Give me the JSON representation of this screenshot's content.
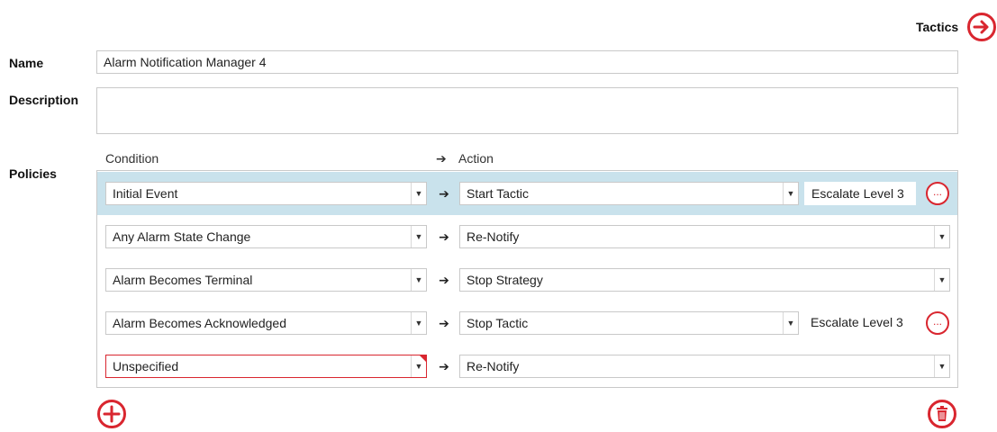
{
  "header": {
    "tactics_label": "Tactics"
  },
  "form": {
    "name_label": "Name",
    "name_value": "Alarm Notification Manager 4",
    "description_label": "Description",
    "description_value": "",
    "policies_label": "Policies"
  },
  "policies": {
    "condition_header": "Condition",
    "action_header_arrow": "➔",
    "action_header": "Action",
    "rows": [
      {
        "condition": "Initial Event",
        "action": "Start Tactic",
        "tactic": "Escalate Level 3",
        "selected": true
      },
      {
        "condition": "Any Alarm State Change",
        "action": "Re-Notify",
        "tactic": ""
      },
      {
        "condition": "Alarm Becomes Terminal",
        "action": "Stop Strategy",
        "tactic": ""
      },
      {
        "condition": "Alarm Becomes Acknowledged",
        "action": "Stop Tactic",
        "tactic": "Escalate Level 3"
      },
      {
        "condition": "Unspecified",
        "action": "Re-Notify",
        "tactic": "",
        "invalid": true
      }
    ],
    "row_arrow": "➔",
    "ellipsis": "..."
  },
  "colors": {
    "accent": "#d9262f",
    "selected_row": "#c9e2ec",
    "border": "#c9c9c9"
  },
  "icons": {
    "tactics": "arrow-right-circle-icon",
    "add": "plus-circle-icon",
    "delete": "trash-circle-icon",
    "dropdown": "chevron-down-icon"
  }
}
